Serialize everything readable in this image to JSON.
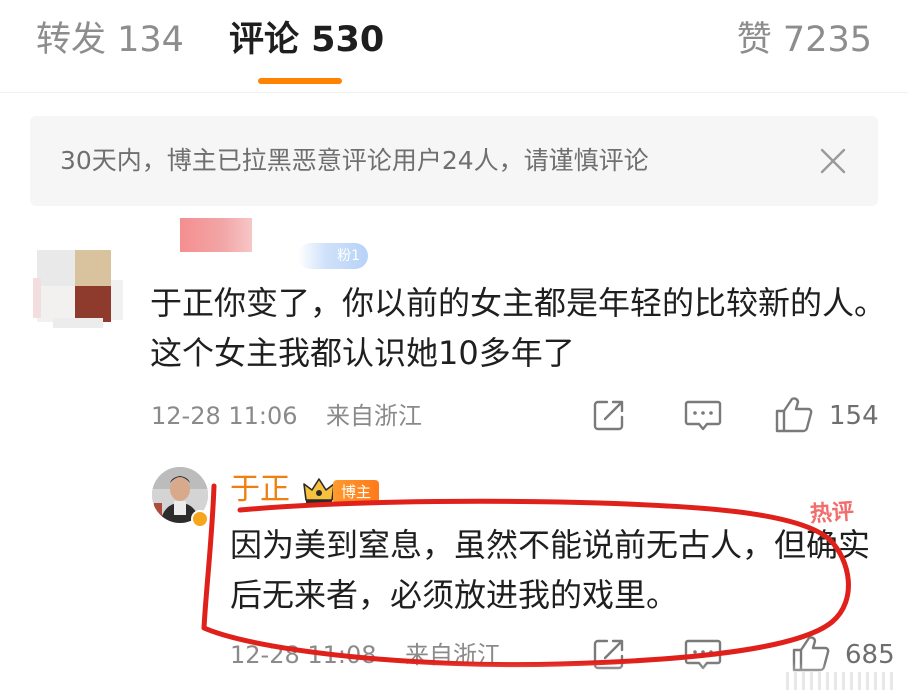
{
  "tabs": {
    "repost": "转发 134",
    "comments": "评论 530",
    "likes": "赞 7235",
    "accent": "#ff8200"
  },
  "notice": {
    "text": "30天内，博主已拉黑恶意评论用户24人，请谨慎评论",
    "close_icon": "close-icon"
  },
  "comment": {
    "badge": "粉1",
    "text": "于正你变了，你以前的女主都是年轻的比较新的人。这个女主我都认识她10多年了",
    "time": "12-28 11:06",
    "source": "来自浙江",
    "likes": "154",
    "icons": [
      "share-icon",
      "comment-icon",
      "like-icon"
    ]
  },
  "reply": {
    "name": "于正",
    "badge": "博主",
    "hot_badge": "热评",
    "text": "因为美到窒息，虽然不能说前无古人，但确实后无来者，必须放进我的戏里。",
    "time": "12-28 11:08",
    "source": "来自浙江",
    "likes": "685",
    "name_color": "#f07f10",
    "annotation_color": "#e0201a"
  }
}
